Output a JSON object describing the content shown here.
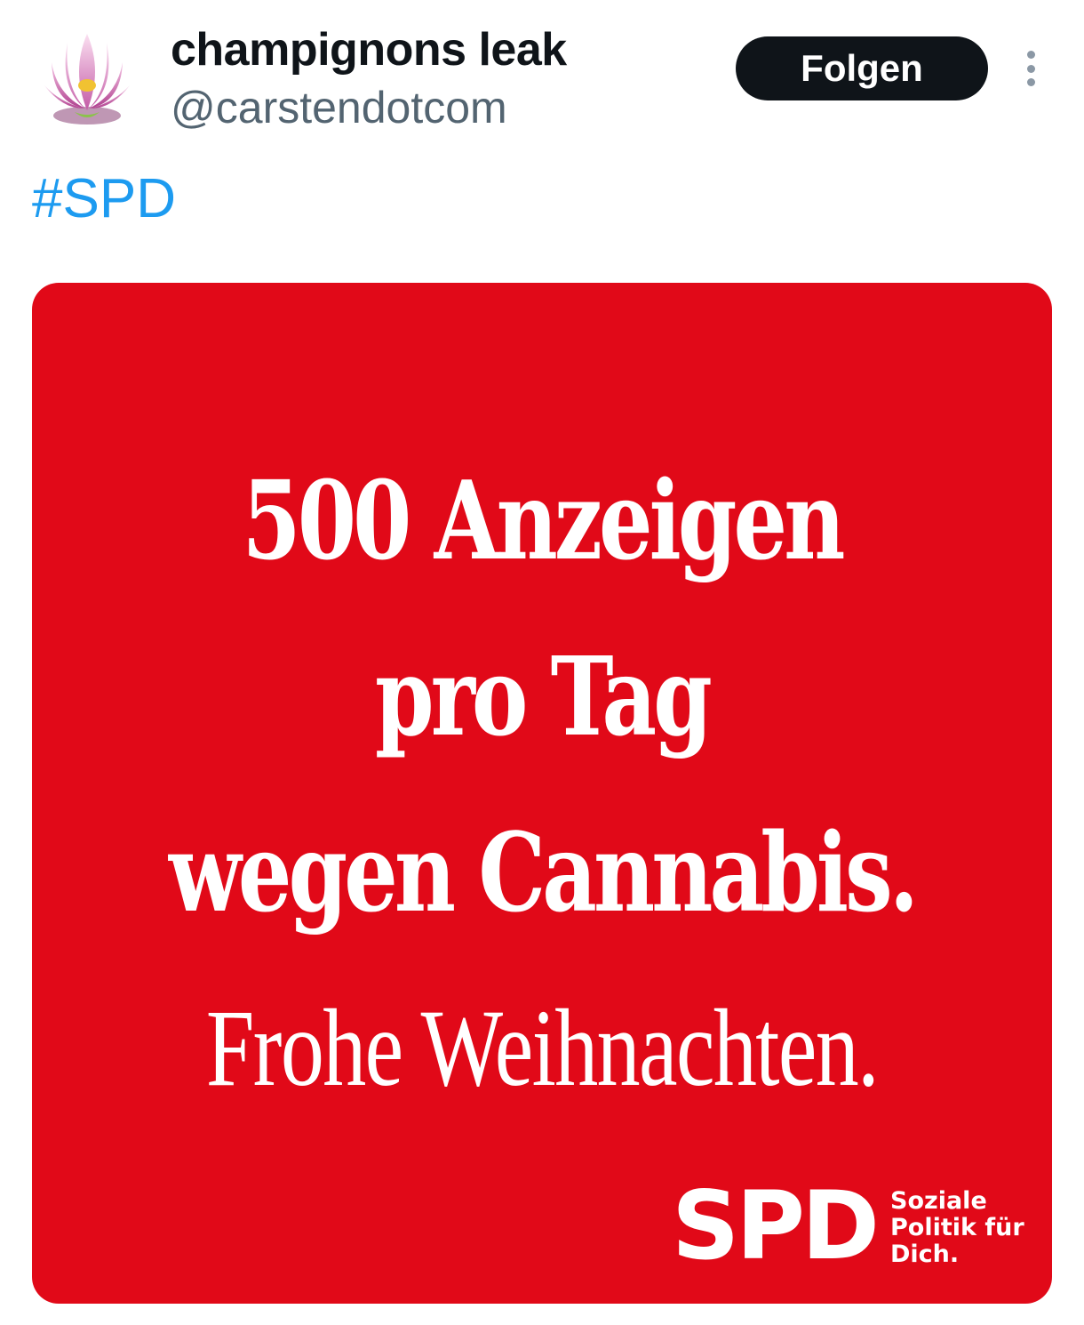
{
  "author": {
    "display_name": "champignons leak",
    "handle": "@carstendotcom",
    "avatar_icon": "lotus-flower-icon"
  },
  "follow_label": "Folgen",
  "more_icon": "more-vertical-icon",
  "tweet_text": {
    "hashtag": "#SPD"
  },
  "media": {
    "background_color": "#e10918",
    "headline_lines": [
      "500 Anzeigen",
      "pro Tag",
      "wegen Cannabis."
    ],
    "greeting": "Frohe Weihnachten.",
    "logo_text": "SPD",
    "slogan_lines": [
      "Soziale",
      "Politik für",
      "Dich."
    ]
  },
  "colors": {
    "follow_button_bg": "#0f1419",
    "hashtag": "#1d9bf0",
    "handle": "#536471"
  }
}
